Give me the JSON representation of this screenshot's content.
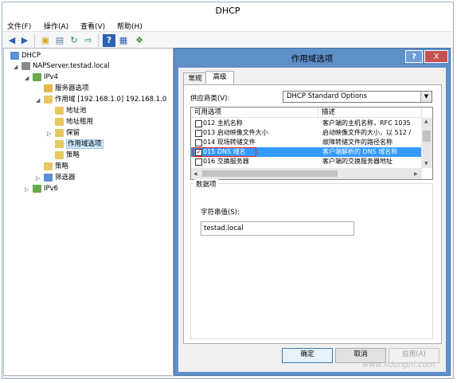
{
  "window": {
    "title": "DHCP",
    "menu": [
      "文件(F)",
      "操作(A)",
      "查看(V)",
      "帮助(H)"
    ]
  },
  "toolbar": {
    "icons": [
      "back-icon",
      "forward-icon",
      "up-folder-icon",
      "properties-icon",
      "refresh-icon",
      "export-icon",
      "help-icon",
      "details-icon",
      "connect-icon"
    ]
  },
  "tree": {
    "items": [
      {
        "label": "DHCP",
        "icon": "dhcp-icon"
      },
      {
        "label": "NAPServer.testad.local",
        "icon": "server-icon"
      },
      {
        "label": "IPv4",
        "icon": "ipv4-icon"
      },
      {
        "label": "服务器选项",
        "icon": "server-options-icon"
      },
      {
        "label": "作用域 [192.168.1.0] 192.168.1.0",
        "icon": "folder-icon"
      },
      {
        "label": "地址池",
        "icon": "folder-icon"
      },
      {
        "label": "地址租用",
        "icon": "folder-icon"
      },
      {
        "label": "保留",
        "icon": "folder-icon"
      },
      {
        "label": "作用域选项",
        "icon": "folder-icon"
      },
      {
        "label": "策略",
        "icon": "folder-icon"
      },
      {
        "label": "策略",
        "icon": "folder-icon"
      },
      {
        "label": "筛选器",
        "icon": "filter-icon"
      },
      {
        "label": "IPv6",
        "icon": "ipv6-icon"
      }
    ]
  },
  "dialog": {
    "title": "作用域选项",
    "help_label": "?",
    "close_label": "X",
    "tabs": [
      "常规",
      "高级"
    ],
    "vendor_label": "供应商类(V):",
    "vendor_value": "DHCP Standard Options",
    "available_label": "可用选项",
    "description_label": "描述",
    "options": [
      {
        "name": "012 主机名称",
        "desc": "客户端的主机名称，RFC 1035",
        "checked": false
      },
      {
        "name": "013 启动映像文件大小",
        "desc": "启动映像文件的大小，以 512 /",
        "checked": false
      },
      {
        "name": "014 现场转储文件",
        "desc": "故障转储文件的路径名称",
        "checked": false
      },
      {
        "name": "015 DNS 域名",
        "desc": "客户端解析的 DNS 域名称",
        "checked": true
      },
      {
        "name": "016 交换服务器",
        "desc": "客户端的交换服务器地址",
        "checked": false
      }
    ],
    "data_group_label": "数据项",
    "string_label": "字符串值(S):",
    "string_value": "testad.local",
    "ok_label": "确定",
    "cancel_label": "取消",
    "apply_label": "应用(A)"
  },
  "watermark": "www.lidongni.com"
}
